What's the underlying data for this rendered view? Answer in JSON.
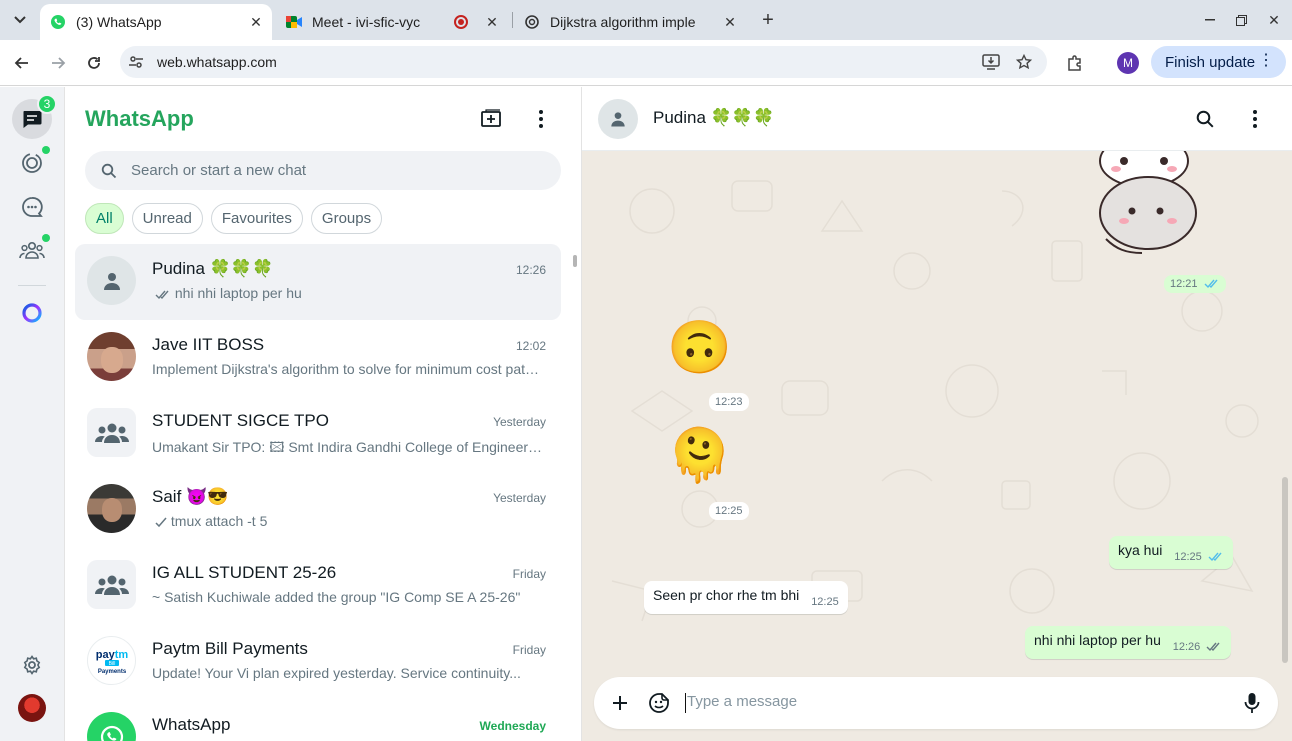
{
  "browser": {
    "tabs": [
      {
        "title": "(3) WhatsApp",
        "icon": "whatsapp-icon",
        "active": true
      },
      {
        "title": "Meet - ivi-sfic-vyc",
        "icon": "meet-icon",
        "active": false
      },
      {
        "title": "Dijkstra algorithm imple",
        "icon": "chatgpt-icon",
        "active": false
      }
    ],
    "url": "web.whatsapp.com",
    "profile_initial": "M",
    "update_button": "Finish update"
  },
  "rail": {
    "chats_badge": "3"
  },
  "sidebar": {
    "title": "WhatsApp",
    "search_placeholder": "Search or start a new chat",
    "filters": [
      "All",
      "Unread",
      "Favourites",
      "Groups"
    ],
    "chats": [
      {
        "name": "Pudina 🍀🍀🍀",
        "time": "12:26",
        "preview": "nhi nhi laptop per hu",
        "avatar": "default",
        "selected": true,
        "ticks": "double"
      },
      {
        "name": "Jave IIT BOSS",
        "time": "12:02",
        "preview": "Implement Dijkstra's algorithm to solve for minimum cost path...",
        "avatar": "photo1"
      },
      {
        "name": "STUDENT SIGCE TPO",
        "time": "Yesterday",
        "preview": "Umakant Sir TPO: 🖾 Smt Indira Gandhi College of Engineering...",
        "avatar": "group"
      },
      {
        "name": "Saif 😈😎",
        "time": "Yesterday",
        "preview": "tmux attach -t 5",
        "avatar": "photo2",
        "ticks": "single"
      },
      {
        "name": "IG ALL STUDENT 25-26",
        "time": "Friday",
        "preview": "~ Satish Kuchiwale added the group \"IG Comp SE A 25-26\"",
        "avatar": "group"
      },
      {
        "name": "Paytm Bill Payments",
        "time": "Friday",
        "preview": "Update!  Your Vi plan expired yesterday.   Service continuity...",
        "avatar": "paytm"
      },
      {
        "name": "WhatsApp",
        "time": "Wednesday",
        "preview": "",
        "avatar": "whatsapp",
        "time_green": true
      }
    ]
  },
  "conversation": {
    "contact": "Pudina 🍀🍀🍀",
    "messages": [
      {
        "kind": "sticker",
        "dir": "out",
        "time": "12:21"
      },
      {
        "kind": "emoji",
        "dir": "in",
        "emoji": "🙃",
        "time": "12:23"
      },
      {
        "kind": "emoji",
        "dir": "in",
        "emoji": "🫠",
        "time": "12:25"
      },
      {
        "kind": "text",
        "dir": "out",
        "text": "kya hui",
        "time": "12:25"
      },
      {
        "kind": "text",
        "dir": "in",
        "text": "Seen pr chor rhe tm bhi",
        "time": "12:25"
      },
      {
        "kind": "text",
        "dir": "out",
        "text": "nhi nhi laptop per hu",
        "time": "12:26"
      }
    ],
    "composer_placeholder": "Type a message"
  },
  "colors": {
    "accent": "#25d366",
    "brand_text": "#25a55d",
    "outgoing_bubble": "#d9fdd3",
    "wallpaper": "#efeae2",
    "read_ticks": "#53bdeb"
  }
}
